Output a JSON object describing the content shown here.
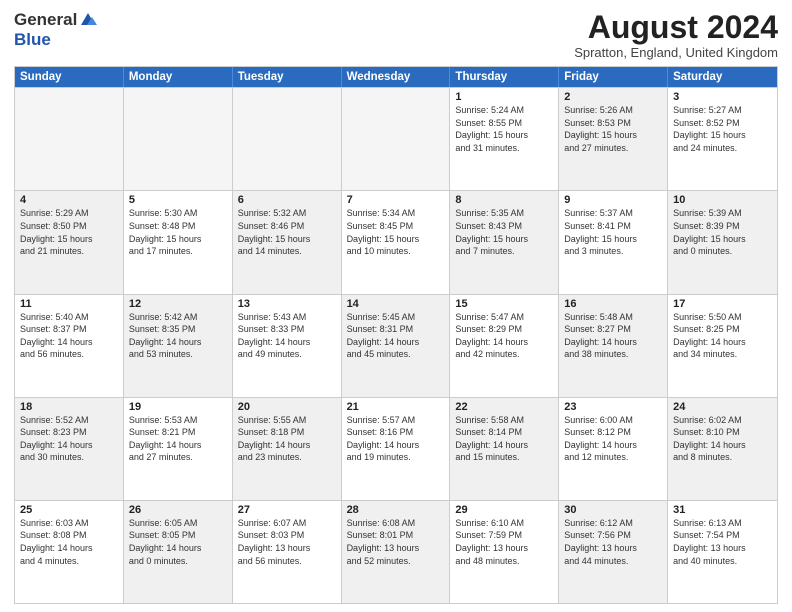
{
  "header": {
    "logo_general": "General",
    "logo_blue": "Blue",
    "month_year": "August 2024",
    "location": "Spratton, England, United Kingdom"
  },
  "days_of_week": [
    "Sunday",
    "Monday",
    "Tuesday",
    "Wednesday",
    "Thursday",
    "Friday",
    "Saturday"
  ],
  "weeks": [
    [
      {
        "day": "",
        "info": "",
        "empty": true
      },
      {
        "day": "",
        "info": "",
        "empty": true
      },
      {
        "day": "",
        "info": "",
        "empty": true
      },
      {
        "day": "",
        "info": "",
        "empty": true
      },
      {
        "day": "1",
        "info": "Sunrise: 5:24 AM\nSunset: 8:55 PM\nDaylight: 15 hours\nand 31 minutes.",
        "shaded": false
      },
      {
        "day": "2",
        "info": "Sunrise: 5:26 AM\nSunset: 8:53 PM\nDaylight: 15 hours\nand 27 minutes.",
        "shaded": true
      },
      {
        "day": "3",
        "info": "Sunrise: 5:27 AM\nSunset: 8:52 PM\nDaylight: 15 hours\nand 24 minutes.",
        "shaded": false
      }
    ],
    [
      {
        "day": "4",
        "info": "Sunrise: 5:29 AM\nSunset: 8:50 PM\nDaylight: 15 hours\nand 21 minutes.",
        "shaded": true
      },
      {
        "day": "5",
        "info": "Sunrise: 5:30 AM\nSunset: 8:48 PM\nDaylight: 15 hours\nand 17 minutes.",
        "shaded": false
      },
      {
        "day": "6",
        "info": "Sunrise: 5:32 AM\nSunset: 8:46 PM\nDaylight: 15 hours\nand 14 minutes.",
        "shaded": true
      },
      {
        "day": "7",
        "info": "Sunrise: 5:34 AM\nSunset: 8:45 PM\nDaylight: 15 hours\nand 10 minutes.",
        "shaded": false
      },
      {
        "day": "8",
        "info": "Sunrise: 5:35 AM\nSunset: 8:43 PM\nDaylight: 15 hours\nand 7 minutes.",
        "shaded": true
      },
      {
        "day": "9",
        "info": "Sunrise: 5:37 AM\nSunset: 8:41 PM\nDaylight: 15 hours\nand 3 minutes.",
        "shaded": false
      },
      {
        "day": "10",
        "info": "Sunrise: 5:39 AM\nSunset: 8:39 PM\nDaylight: 15 hours\nand 0 minutes.",
        "shaded": true
      }
    ],
    [
      {
        "day": "11",
        "info": "Sunrise: 5:40 AM\nSunset: 8:37 PM\nDaylight: 14 hours\nand 56 minutes.",
        "shaded": false
      },
      {
        "day": "12",
        "info": "Sunrise: 5:42 AM\nSunset: 8:35 PM\nDaylight: 14 hours\nand 53 minutes.",
        "shaded": true
      },
      {
        "day": "13",
        "info": "Sunrise: 5:43 AM\nSunset: 8:33 PM\nDaylight: 14 hours\nand 49 minutes.",
        "shaded": false
      },
      {
        "day": "14",
        "info": "Sunrise: 5:45 AM\nSunset: 8:31 PM\nDaylight: 14 hours\nand 45 minutes.",
        "shaded": true
      },
      {
        "day": "15",
        "info": "Sunrise: 5:47 AM\nSunset: 8:29 PM\nDaylight: 14 hours\nand 42 minutes.",
        "shaded": false
      },
      {
        "day": "16",
        "info": "Sunrise: 5:48 AM\nSunset: 8:27 PM\nDaylight: 14 hours\nand 38 minutes.",
        "shaded": true
      },
      {
        "day": "17",
        "info": "Sunrise: 5:50 AM\nSunset: 8:25 PM\nDaylight: 14 hours\nand 34 minutes.",
        "shaded": false
      }
    ],
    [
      {
        "day": "18",
        "info": "Sunrise: 5:52 AM\nSunset: 8:23 PM\nDaylight: 14 hours\nand 30 minutes.",
        "shaded": true
      },
      {
        "day": "19",
        "info": "Sunrise: 5:53 AM\nSunset: 8:21 PM\nDaylight: 14 hours\nand 27 minutes.",
        "shaded": false
      },
      {
        "day": "20",
        "info": "Sunrise: 5:55 AM\nSunset: 8:18 PM\nDaylight: 14 hours\nand 23 minutes.",
        "shaded": true
      },
      {
        "day": "21",
        "info": "Sunrise: 5:57 AM\nSunset: 8:16 PM\nDaylight: 14 hours\nand 19 minutes.",
        "shaded": false
      },
      {
        "day": "22",
        "info": "Sunrise: 5:58 AM\nSunset: 8:14 PM\nDaylight: 14 hours\nand 15 minutes.",
        "shaded": true
      },
      {
        "day": "23",
        "info": "Sunrise: 6:00 AM\nSunset: 8:12 PM\nDaylight: 14 hours\nand 12 minutes.",
        "shaded": false
      },
      {
        "day": "24",
        "info": "Sunrise: 6:02 AM\nSunset: 8:10 PM\nDaylight: 14 hours\nand 8 minutes.",
        "shaded": true
      }
    ],
    [
      {
        "day": "25",
        "info": "Sunrise: 6:03 AM\nSunset: 8:08 PM\nDaylight: 14 hours\nand 4 minutes.",
        "shaded": false
      },
      {
        "day": "26",
        "info": "Sunrise: 6:05 AM\nSunset: 8:05 PM\nDaylight: 14 hours\nand 0 minutes.",
        "shaded": true
      },
      {
        "day": "27",
        "info": "Sunrise: 6:07 AM\nSunset: 8:03 PM\nDaylight: 13 hours\nand 56 minutes.",
        "shaded": false
      },
      {
        "day": "28",
        "info": "Sunrise: 6:08 AM\nSunset: 8:01 PM\nDaylight: 13 hours\nand 52 minutes.",
        "shaded": true
      },
      {
        "day": "29",
        "info": "Sunrise: 6:10 AM\nSunset: 7:59 PM\nDaylight: 13 hours\nand 48 minutes.",
        "shaded": false
      },
      {
        "day": "30",
        "info": "Sunrise: 6:12 AM\nSunset: 7:56 PM\nDaylight: 13 hours\nand 44 minutes.",
        "shaded": true
      },
      {
        "day": "31",
        "info": "Sunrise: 6:13 AM\nSunset: 7:54 PM\nDaylight: 13 hours\nand 40 minutes.",
        "shaded": false
      }
    ]
  ]
}
